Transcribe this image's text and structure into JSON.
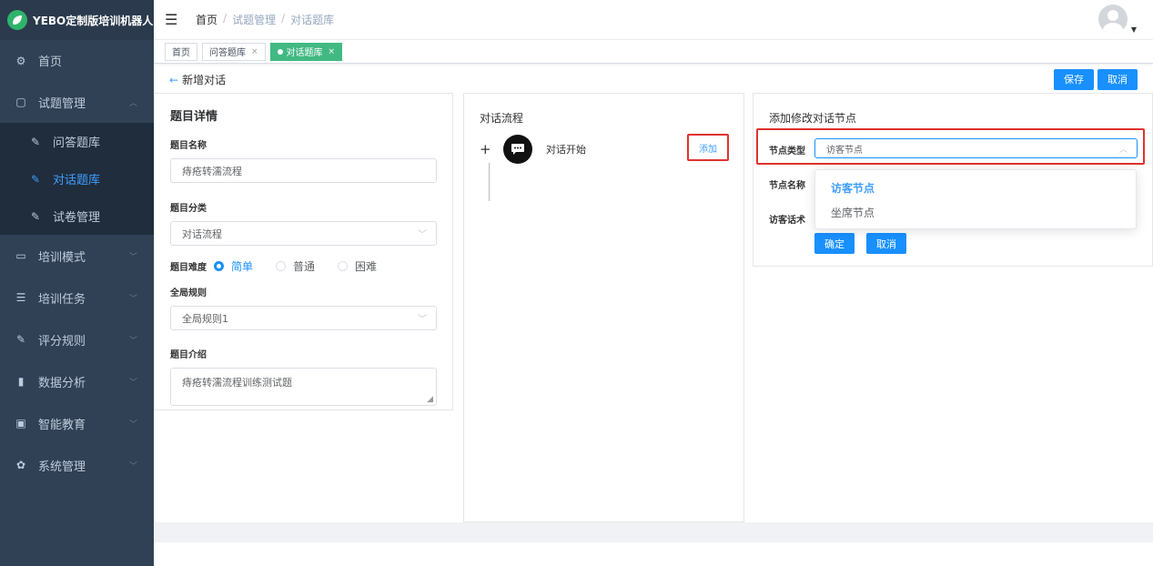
{
  "app": {
    "logo_text": "YEBO定制版培训机器人"
  },
  "sidebar": {
    "items": [
      {
        "label": "首页",
        "icon": "dashboard-icon"
      },
      {
        "label": "试题管理",
        "icon": "book-icon",
        "expanded": true
      },
      {
        "label": "问答题库",
        "icon": "edit-icon"
      },
      {
        "label": "对话题库",
        "icon": "edit-icon",
        "active": true
      },
      {
        "label": "试卷管理",
        "icon": "edit-icon"
      },
      {
        "label": "培训模式",
        "icon": "monitor-icon"
      },
      {
        "label": "培训任务",
        "icon": "list-icon"
      },
      {
        "label": "评分规则",
        "icon": "edit-icon"
      },
      {
        "label": "数据分析",
        "icon": "chart-icon"
      },
      {
        "label": "智能教育",
        "icon": "screen-icon"
      },
      {
        "label": "系统管理",
        "icon": "gear-icon"
      }
    ]
  },
  "breadcrumb": {
    "home": "首页",
    "mid": "试题管理",
    "current": "对话题库",
    "sep": "/"
  },
  "tags": {
    "t1": "首页",
    "t2": "问答题库",
    "t3": "对话题库",
    "close": "×"
  },
  "toolbar": {
    "back_label": "新增对话",
    "save": "保存",
    "cancel": "取消"
  },
  "detail": {
    "title": "题目详情",
    "name_label": "题目名称",
    "name_value": "痔疮转濡流程",
    "category_label": "题目分类",
    "category_value": "对话流程",
    "difficulty_label": "题目难度",
    "difficulty_options": [
      "简单",
      "普通",
      "困难"
    ],
    "difficulty_selected": "简单",
    "rule_label": "全局规则",
    "rule_value": "全局规则1",
    "intro_label": "题目介绍",
    "intro_value": "痔疮转濡流程训练测试题"
  },
  "flow": {
    "title": "对话流程",
    "start_label": "对话开始",
    "add_label": "添加"
  },
  "node": {
    "title": "添加修改对话节点",
    "type_label": "节点类型",
    "type_value": "访客节点",
    "name_label": "节点名称",
    "speech_label": "访客话术",
    "options": [
      "访客节点",
      "坐席节点"
    ],
    "ok": "确定",
    "cancel": "取消"
  },
  "colors": {
    "primary": "#1890ff",
    "tag_active": "#42b983",
    "sidebar_bg": "#304156",
    "highlight": "#e0322f"
  }
}
